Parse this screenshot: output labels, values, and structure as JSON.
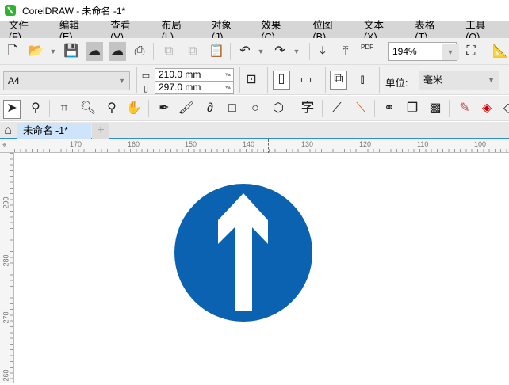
{
  "title": "CorelDRAW - 未命名 -1*",
  "menu": [
    "文件(F)",
    "编辑(E)",
    "查看(V)",
    "布局(L)",
    "对象(J)",
    "效果(C)",
    "位图(B)",
    "文本(X)",
    "表格(T)",
    "工具(O)"
  ],
  "toolbar": {
    "zoom": "194%",
    "pdf": "PDF"
  },
  "property_bar": {
    "page_size": "A4",
    "width": "210.0 mm",
    "height": "297.0 mm",
    "units_label": "单位:",
    "units": "毫米"
  },
  "toolbox": {
    "text_tool": "字"
  },
  "tabs": [
    {
      "label": "未命名 -1*"
    }
  ],
  "ruler": {
    "h": [
      "170",
      "160",
      "150",
      "140",
      "130",
      "120",
      "110",
      "100"
    ],
    "v": [
      "290",
      "280",
      "270",
      "260"
    ]
  },
  "sign": {
    "color": "#0a62b0"
  }
}
